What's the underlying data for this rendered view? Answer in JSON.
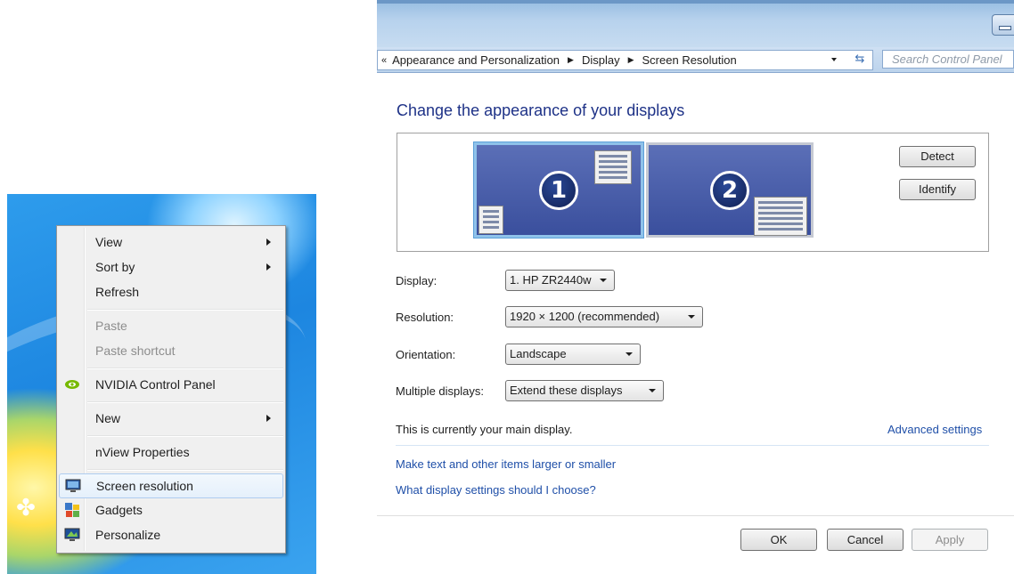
{
  "context_menu": {
    "items": [
      {
        "label": "View",
        "submenu": true
      },
      {
        "label": "Sort by",
        "submenu": true
      },
      {
        "label": "Refresh"
      },
      {
        "label": "Paste",
        "disabled": true
      },
      {
        "label": "Paste shortcut",
        "disabled": true
      },
      {
        "label": "NVIDIA Control Panel",
        "icon": "nvidia-icon"
      },
      {
        "label": "New",
        "submenu": true
      },
      {
        "label": "nView Properties"
      },
      {
        "label": "Screen resolution",
        "icon": "screen-resolution-icon",
        "highlighted": true
      },
      {
        "label": "Gadgets",
        "icon": "gadgets-icon"
      },
      {
        "label": "Personalize",
        "icon": "personalize-icon"
      }
    ]
  },
  "window": {
    "breadcrumb": {
      "overflow": "«",
      "items": [
        "Appearance and Personalization",
        "Display",
        "Screen Resolution"
      ]
    },
    "search_placeholder": "Search Control Panel",
    "title": "Change the appearance of your displays",
    "monitors": [
      {
        "number": "1",
        "selected": true
      },
      {
        "number": "2",
        "selected": false
      }
    ],
    "detect_label": "Detect",
    "identify_label": "Identify",
    "fields": {
      "display": {
        "label": "Display:",
        "value": "1. HP ZR2440w"
      },
      "resolution": {
        "label": "Resolution:",
        "value": "1920 × 1200 (recommended)"
      },
      "orientation": {
        "label": "Orientation:",
        "value": "Landscape"
      },
      "multiple_displays": {
        "label": "Multiple displays:",
        "value": "Extend these displays"
      }
    },
    "main_display_text": "This is currently your main display.",
    "advanced_settings_link": "Advanced settings",
    "links": {
      "larger_text": "Make text and other items larger or smaller",
      "which_settings": "What display settings should I choose?"
    },
    "buttons": {
      "ok": "OK",
      "cancel": "Cancel",
      "apply": "Apply"
    }
  },
  "colors": {
    "link": "#1f4fa8",
    "title": "#1e3287",
    "monitor_fill": "#3a4f9d",
    "selected_border": "#8fc2ea"
  }
}
